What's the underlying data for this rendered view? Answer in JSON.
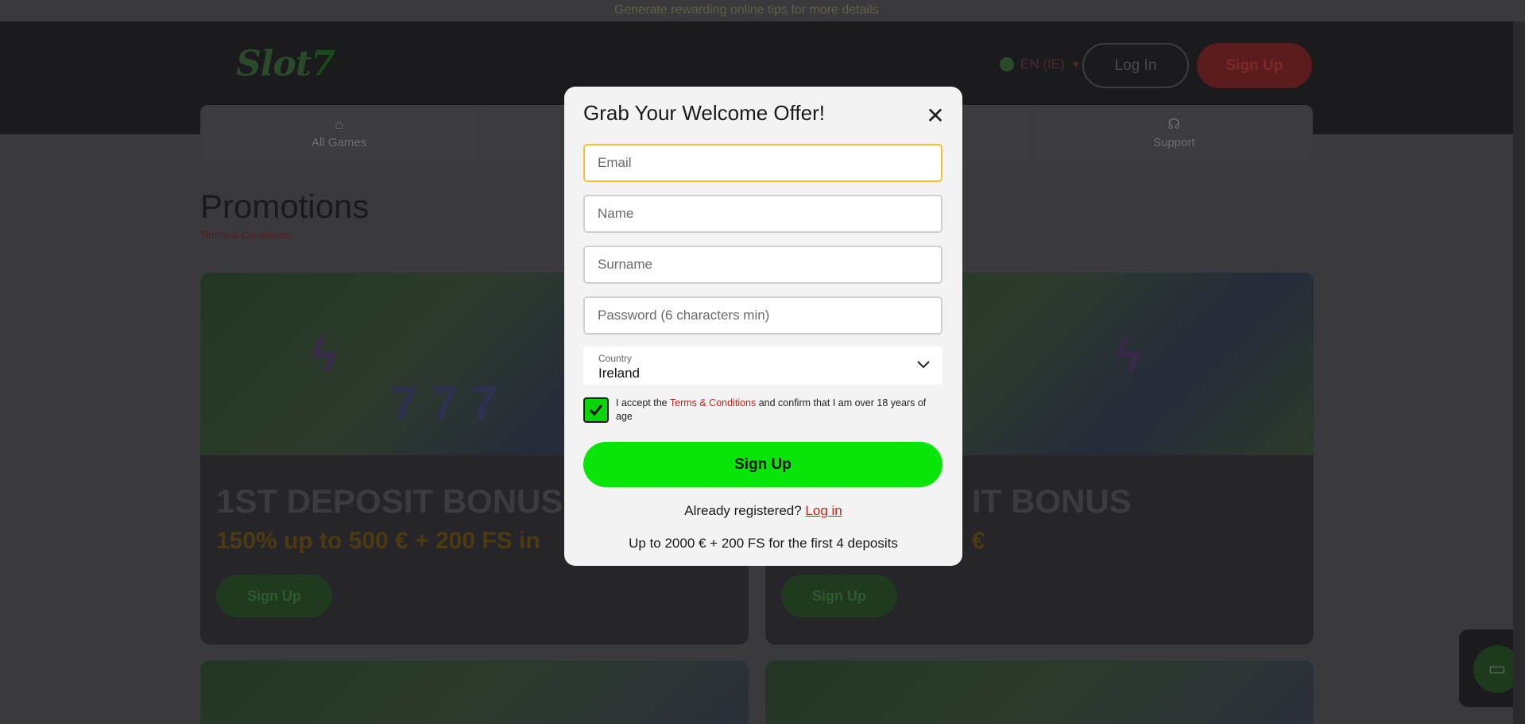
{
  "topbar": {
    "text": "Generate rewarding online tips for more details"
  },
  "header": {
    "logo": "Slot",
    "logo_accent": "7",
    "language": "EN (IE)",
    "login_label": "Log In",
    "signup_label": "Sign Up"
  },
  "nav": {
    "items": [
      {
        "label": "All Games",
        "icon": "games-icon"
      },
      {
        "label": "",
        "icon": ""
      },
      {
        "label": "",
        "icon": ""
      },
      {
        "label": "Support",
        "icon": "support-icon"
      }
    ]
  },
  "promotions": {
    "title": "Promotions",
    "subtitle": "Terms & Conditions",
    "cards": [
      {
        "title": "1ST DEPOSIT BONUS",
        "offer": "150% up to 500 € + 200 FS in",
        "button": "Sign Up"
      },
      {
        "title": "IT BONUS",
        "offer": "€",
        "button": "Sign Up"
      }
    ]
  },
  "modal": {
    "title": "Grab Your Welcome Offer!",
    "email_placeholder": "Email",
    "name_placeholder": "Name",
    "surname_placeholder": "Surname",
    "password_placeholder": "Password (6 characters min)",
    "country_label": "Country",
    "country_value": "Ireland",
    "terms_prefix": "I accept the ",
    "terms_link": "Terms & Conditions",
    "terms_suffix": " and confirm that I am over 18 years of age",
    "terms_checked": true,
    "signup_label": "Sign Up",
    "already_text": "Already registered? ",
    "login_link": "Log in",
    "bonus_text": "Up to 2000 € + 200 FS for the first 4 deposits"
  },
  "colors": {
    "accent_green": "#09e509",
    "link_red": "#c0241c",
    "focus_yellow": "#f2c230"
  }
}
